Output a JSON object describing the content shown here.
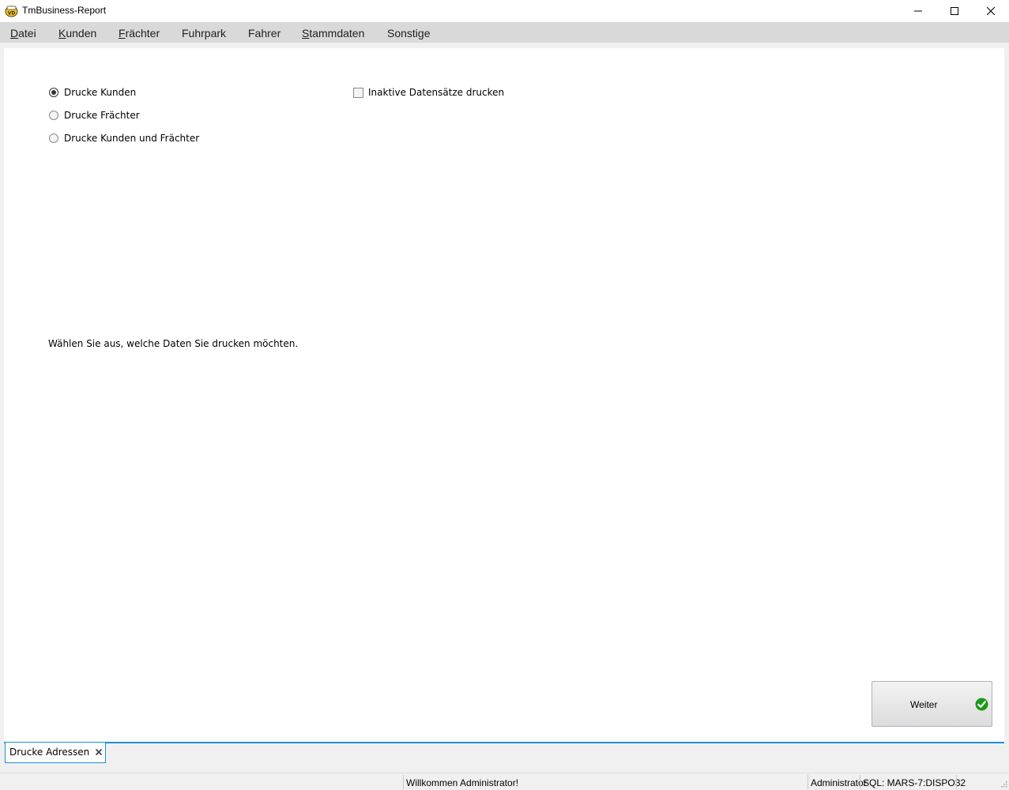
{
  "window": {
    "title": "TmBusiness-Report",
    "icon": "app-logo-icon",
    "controls": [
      "minimize-icon",
      "maximize-icon",
      "close-icon"
    ]
  },
  "menu": {
    "items": [
      {
        "accel": "D",
        "rest": "atei"
      },
      {
        "accel": "K",
        "rest": "unden"
      },
      {
        "accel": "F",
        "rest": "rächter"
      },
      {
        "accel": "",
        "rest": "Fuhrpark"
      },
      {
        "accel": "",
        "rest": "Fahrer"
      },
      {
        "accel": "S",
        "rest": "tammdaten"
      },
      {
        "accel": "",
        "rest": "Sonstige"
      }
    ]
  },
  "form": {
    "options": [
      {
        "label": "Drucke Kunden",
        "selected": true
      },
      {
        "label": "Drucke Frächter",
        "selected": false
      },
      {
        "label": "Drucke Kunden und Frächter",
        "selected": false
      }
    ],
    "inactive_checkbox": {
      "label": "Inaktive Datensätze drucken",
      "checked": false
    },
    "hint": "Wählen Sie aus, welche Daten Sie drucken möchten."
  },
  "actions": {
    "next_label": "Weiter",
    "next_icon": "green-check-icon"
  },
  "tabs": [
    {
      "label": "Drucke Adressen",
      "active": true
    }
  ],
  "status": {
    "welcome": "Willkommen Administrator!",
    "user": "Administrator",
    "connection": "SQL: MARS-7:DISPO32"
  },
  "colors": {
    "accent": "#1a91d6",
    "menubar": "#d9d9d9",
    "frame": "#f0f0f0",
    "check_green": "#1a9a1a"
  }
}
